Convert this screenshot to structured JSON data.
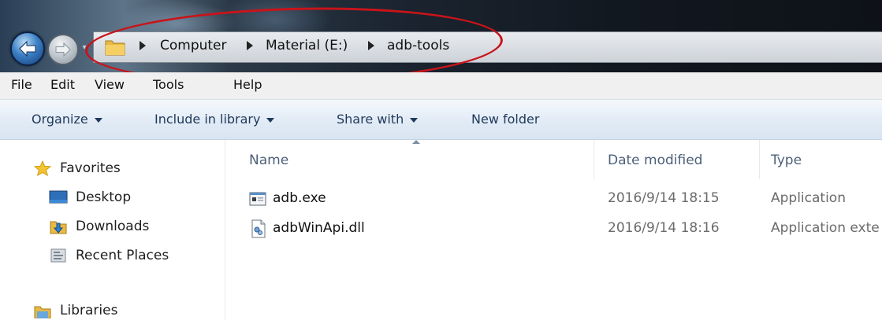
{
  "address_bar": {
    "breadcrumbs": [
      "Computer",
      "Material (E:)",
      "adb-tools"
    ]
  },
  "menu": {
    "items": [
      "File",
      "Edit",
      "View",
      "Tools",
      "Help"
    ]
  },
  "command_bar": {
    "organize": "Organize",
    "include_in_library": "Include in library",
    "share_with": "Share with",
    "new_folder": "New folder"
  },
  "nav_pane": {
    "favorites": "Favorites",
    "desktop": "Desktop",
    "downloads": "Downloads",
    "recent_places": "Recent Places",
    "libraries": "Libraries"
  },
  "file_list": {
    "columns": {
      "name": "Name",
      "date_modified": "Date modified",
      "type": "Type"
    },
    "rows": [
      {
        "name": "adb.exe",
        "date_modified": "2016/9/14 18:15",
        "type": "Application",
        "icon": "exe-icon"
      },
      {
        "name": "adbWinApi.dll",
        "date_modified": "2016/9/14 18:16",
        "type": "Application exte",
        "icon": "dll-icon"
      }
    ]
  },
  "colors": {
    "annotation": "#c8141a",
    "command_text": "#1e395b",
    "header_text": "#4c607a"
  }
}
